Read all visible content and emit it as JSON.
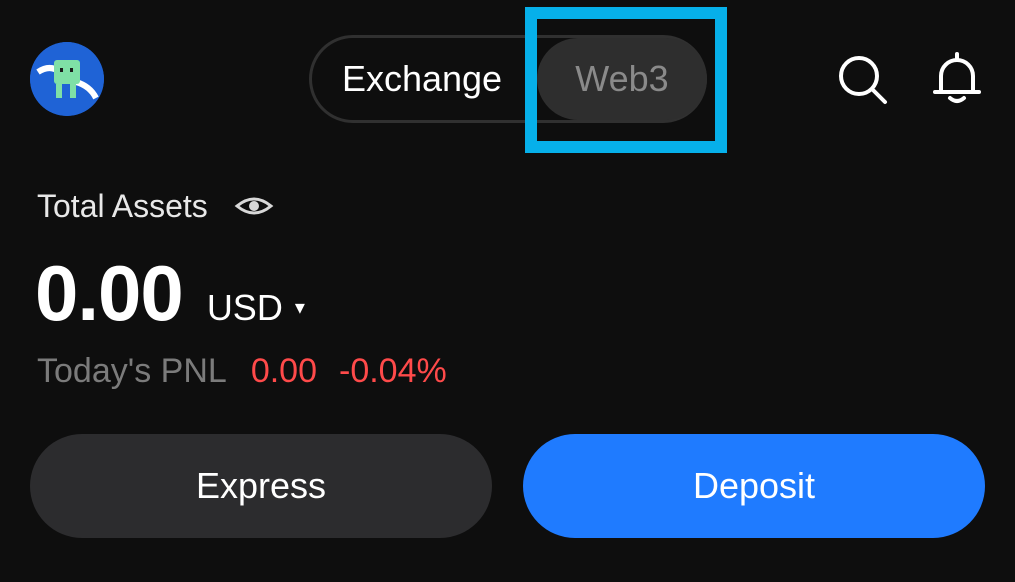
{
  "header": {
    "avatar_icon": "cartoon-character-avatar",
    "tabs": [
      {
        "label": "Exchange",
        "active": true
      },
      {
        "label": "Web3",
        "active": false
      }
    ],
    "highlight_color": "#06b0ea",
    "search_icon": "search-icon",
    "bell_icon": "bell-icon"
  },
  "assets": {
    "label": "Total Assets",
    "eye_icon": "eye-icon",
    "balance": "0.00",
    "currency": "USD",
    "caret": "▾"
  },
  "pnl": {
    "label": "Today's PNL",
    "value": "0.00",
    "percent": "-0.04%",
    "color": "#ff4a4a"
  },
  "actions": {
    "express_label": "Express",
    "deposit_label": "Deposit",
    "deposit_color": "#1f7bff"
  }
}
